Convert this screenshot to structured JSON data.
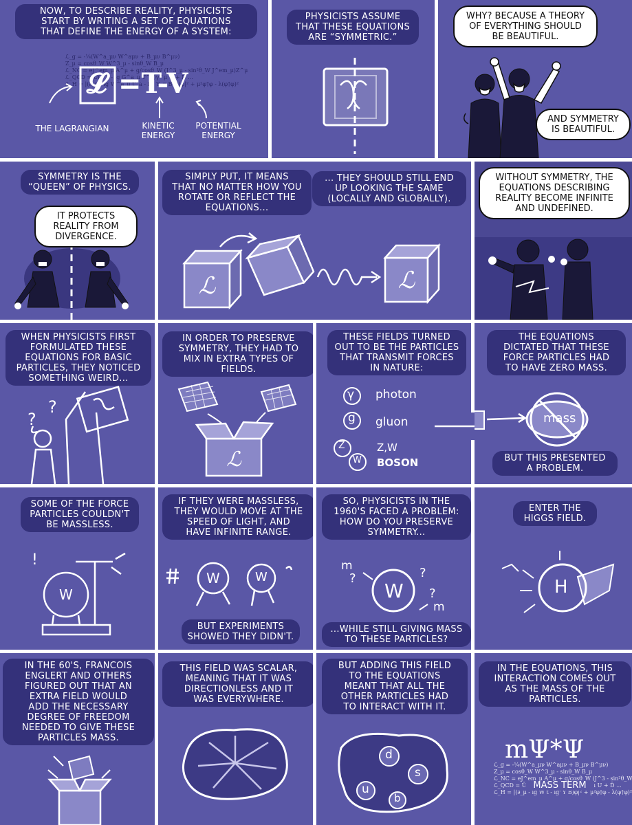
{
  "panels": {
    "p1": {
      "caption": "Now, to describe reality, physicists\nstart by writing a set of equations\nthat define the energy of a system:",
      "lagrangian_symbol": "𝓛",
      "equals_t_minus_v": "=T-V",
      "label_lagrangian": "The Lagrangian",
      "label_kinetic": "Kinetic\nenergy",
      "label_potential": "Potential\nenergy"
    },
    "p2": {
      "caption": "Physicists assume\nthat these equations\nare “symmetric.”"
    },
    "p3": {
      "bubble1": "Why? Because a theory\nof everything should\nbe beautiful.",
      "bubble2": "And symmetry\nis beautiful."
    },
    "p4": {
      "caption": "Symmetry is the\n“queen” of physics.",
      "bubble": "It protects\nreality from\ndivergence."
    },
    "p5": {
      "caption_left": "Simply put, it means\nthat no matter how you\nrotate or reflect the\nequations...",
      "caption_right": "... they should still end\nup looking the same\n(locally and globally)."
    },
    "p6": {
      "bubble": "Without symmetry, the\nequations describing\nreality become infinite\nand undefined."
    },
    "p7": {
      "caption": "When physicists first\nformulated these\nequations for basic\nparticles, they noticed\nsomething weird...",
      "marks": "? ?"
    },
    "p8": {
      "caption": "In order to preserve\nsymmetry, they had to\nmix in extra types of\nfields."
    },
    "p9": {
      "caption": "These fields turned\nout to be the particles\nthat transmit forces\nin nature:",
      "items": [
        {
          "symbol": "γ",
          "name": "photon"
        },
        {
          "symbol": "g",
          "name": "gluon"
        },
        {
          "symbol": "Z",
          "name": "Z,W"
        },
        {
          "symbol": "W",
          "name": "BOSON"
        }
      ]
    },
    "p10": {
      "caption": "The equations\ndictated that these\nforce particles had\nto have zero mass.",
      "mass_label": "mass",
      "caption2": "But this presented\na problem."
    },
    "p11": {
      "caption": "Some of the force\nparticles couldn't\nbe massless.",
      "particle": "W"
    },
    "p12": {
      "caption": "If they were massless,\nthey would move at the\nspeed of light, and\nhave infinite range.",
      "caption2": "But experiments\nshowed they didn't.",
      "particle": "W"
    },
    "p13": {
      "caption": "So, physicists in the\n1960's faced a problem:\nhow do you preserve\nsymmetry...",
      "caption2": "...while still giving mass\nto these particles?",
      "particle": "W",
      "m": "m"
    },
    "p14": {
      "caption": "Enter the\nHiggs field.",
      "particle": "H"
    },
    "p15": {
      "caption": "In the 60's, Francois\nEnglert and others\nfigured out that an\nextra field would\nadd the necessary\ndegree of freedom\nneeded to give these\nparticles mass."
    },
    "p16": {
      "caption": "This field was scalar,\nmeaning that it was\ndirectionless and it\nwas everywhere."
    },
    "p17": {
      "caption": "But adding this field\nto the equations\nmeant that all the\nother particles had\nto interact with it.",
      "particles": [
        "d",
        "s",
        "u",
        "b"
      ]
    },
    "p18": {
      "caption": "In the equations, this\ninteraction comes out\nas the mass of the\nparticles.",
      "mass_expr": "mΨ*Ψ",
      "mass_term": "Mass term"
    }
  },
  "colors": {
    "panel_bg": "#5a57a6",
    "caption_bg": "#34317a",
    "ink": "#ffffff"
  }
}
